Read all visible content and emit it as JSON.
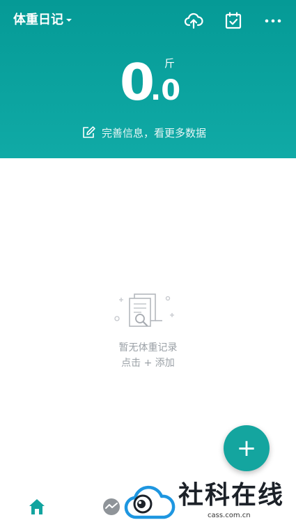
{
  "header": {
    "title": "体重日记",
    "icons": [
      "cloud-upload-icon",
      "calendar-check-icon",
      "more-icon"
    ],
    "accent_color": "#10aaa6"
  },
  "weight": {
    "integer": "0",
    "decimal": ".0",
    "unit": "斤"
  },
  "info_link": "完善信息，看更多数据",
  "empty_state": {
    "line1": "暂无体重记录",
    "line2": "点击 + 添加"
  },
  "fab": {
    "label": "+"
  },
  "tabbar": {
    "items": [
      "home-icon",
      "trend-icon"
    ],
    "active_color": "#12a49f"
  },
  "watermark": {
    "text": "社科在线",
    "subtext": "cass.com.cn"
  }
}
